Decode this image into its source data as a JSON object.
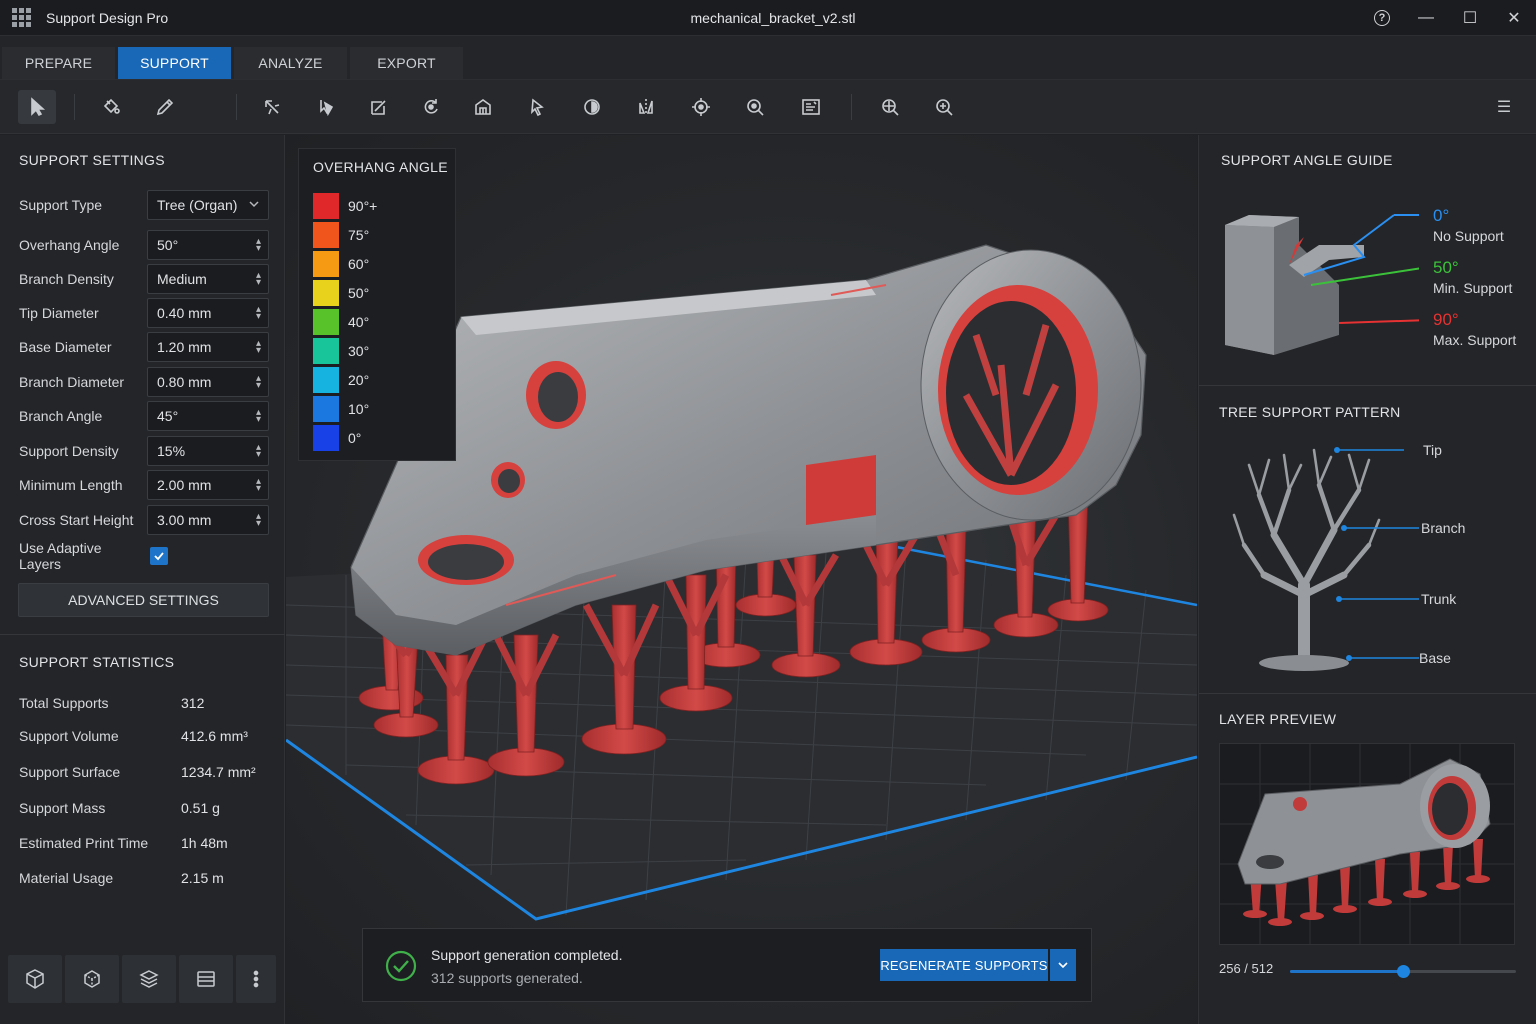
{
  "app": {
    "name": "Support Design Pro",
    "document_title": "mechanical_bracket_v2.stl",
    "help_glyph": "?",
    "minimize_glyph": "—",
    "maximize_glyph": "☐",
    "close_glyph": "✕"
  },
  "tabs": [
    {
      "label": "PREPARE",
      "active": false
    },
    {
      "label": "SUPPORT",
      "active": true
    },
    {
      "label": "ANALYZE",
      "active": false
    },
    {
      "label": "EXPORT",
      "active": false
    }
  ],
  "toolbar": {
    "tools": [
      "select-tool",
      "paint-support-tool",
      "pencil-tool",
      "auto-support-tool",
      "place-support-tool",
      "trim-tool",
      "rotate-tool",
      "block-support-tool",
      "move-support-tool",
      "island-detect-tool",
      "mirror-tool",
      "orient-tool",
      "inspect-tool",
      "report-tool",
      "zoom-extents-tool",
      "zoom-in-tool"
    ],
    "menu_glyph": "☰"
  },
  "support_settings": {
    "title": "SUPPORT SETTINGS",
    "fields": [
      {
        "label": "Support Type",
        "value": "Tree (Organ)",
        "control": "dropdown"
      },
      {
        "label": "Overhang Angle",
        "value": "50°",
        "control": "spinner"
      },
      {
        "label": "Branch Density",
        "value": "Medium",
        "control": "spinner"
      },
      {
        "label": "Tip Diameter",
        "value": "0.40 mm",
        "control": "spinner"
      },
      {
        "label": "Base Diameter",
        "value": "1.20 mm",
        "control": "spinner"
      },
      {
        "label": "Branch Diameter",
        "value": "0.80 mm",
        "control": "spinner"
      },
      {
        "label": "Branch Angle",
        "value": "45°",
        "control": "spinner"
      },
      {
        "label": "Support Density",
        "value": "15%",
        "control": "spinner"
      },
      {
        "label": "Minimum Length",
        "value": "2.00 mm",
        "control": "spinner"
      },
      {
        "label": "Cross Start Height",
        "value": "3.00 mm",
        "control": "spinner"
      }
    ],
    "adaptive_layers": {
      "label": "Use Adaptive Layers",
      "checked": true
    },
    "advanced_button": "ADVANCED SETTINGS"
  },
  "support_statistics": {
    "title": "SUPPORT STATISTICS",
    "rows": [
      {
        "label": "Total Supports",
        "value": "312"
      },
      {
        "label": "Support Volume",
        "value": "412.6 mm³"
      },
      {
        "label": "Support Surface",
        "value": "1234.7 mm²"
      },
      {
        "label": "Support Mass",
        "value": "0.51 g"
      },
      {
        "label": "Estimated Print Time",
        "value": "1h 48m"
      },
      {
        "label": "Material Usage",
        "value": "2.15 m"
      }
    ]
  },
  "view_buttons": [
    "cube-view-icon",
    "iso-view-icon",
    "layers-icon",
    "slices-icon",
    "more-vertical-icon"
  ],
  "overhang_legend": {
    "title": "OVERHANG ANGLE",
    "items": [
      {
        "label": "90°+",
        "color": "#e0282a"
      },
      {
        "label": "75°",
        "color": "#f0561b"
      },
      {
        "label": "60°",
        "color": "#f59a12"
      },
      {
        "label": "50°",
        "color": "#e8d21c"
      },
      {
        "label": "40°",
        "color": "#58c22a"
      },
      {
        "label": "30°",
        "color": "#18c49a"
      },
      {
        "label": "20°",
        "color": "#17b3e0"
      },
      {
        "label": "10°",
        "color": "#1a78e0"
      },
      {
        "label": "0°",
        "color": "#1842e8"
      }
    ]
  },
  "status": {
    "message": "Support generation completed.",
    "detail": "312 supports generated.",
    "regenerate_button": "REGENERATE SUPPORTS"
  },
  "angle_guide": {
    "title": "SUPPORT ANGLE GUIDE",
    "entries": [
      {
        "angle": "0°",
        "description": "No Support",
        "color": "#2a8ff0"
      },
      {
        "angle": "50°",
        "description": "Min. Support",
        "color": "#3cc23a"
      },
      {
        "angle": "90°",
        "description": "Max. Support",
        "color": "#e63232"
      }
    ]
  },
  "tree_pattern": {
    "title": "TREE SUPPORT PATTERN",
    "parts": [
      "Tip",
      "Branch",
      "Trunk",
      "Base"
    ]
  },
  "layer_preview": {
    "title": "LAYER PREVIEW",
    "current_layer": 256,
    "total_layers": 512,
    "counter": "256 / 512"
  },
  "colors": {
    "accent": "#1868b7",
    "support_red": "#c23b3b",
    "model_gray": "#8f9296",
    "success_green": "#3fb04a",
    "grid_border": "#1e86e0"
  }
}
